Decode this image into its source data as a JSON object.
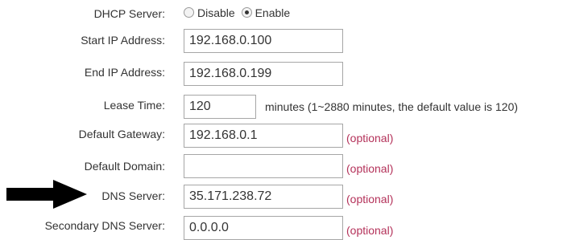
{
  "dhcp": {
    "label": "DHCP Server:",
    "options": [
      "Disable",
      "Enable"
    ],
    "selected": "Enable"
  },
  "fields": {
    "start_ip": {
      "label": "Start IP Address:",
      "value": "192.168.0.100"
    },
    "end_ip": {
      "label": "End IP Address:",
      "value": "192.168.0.199"
    },
    "lease_time": {
      "label": "Lease Time:",
      "value": "120",
      "note": "minutes (1~2880 minutes, the default value is 120)"
    },
    "default_gateway": {
      "label": "Default Gateway:",
      "value": "192.168.0.1",
      "hint": "(optional)"
    },
    "default_domain": {
      "label": "Default Domain:",
      "value": "",
      "hint": "(optional)"
    },
    "dns_server": {
      "label": "DNS Server:",
      "value": "35.171.238.72",
      "hint": "(optional)"
    },
    "secondary_dns": {
      "label": "Secondary DNS Server:",
      "value": "0.0.0.0",
      "hint": "(optional)"
    }
  },
  "colors": {
    "optional_text": "#b4325a",
    "label_text": "#333333",
    "annotation_arrow": "#000000"
  },
  "annotation": {
    "icon": "arrow-right-icon"
  }
}
